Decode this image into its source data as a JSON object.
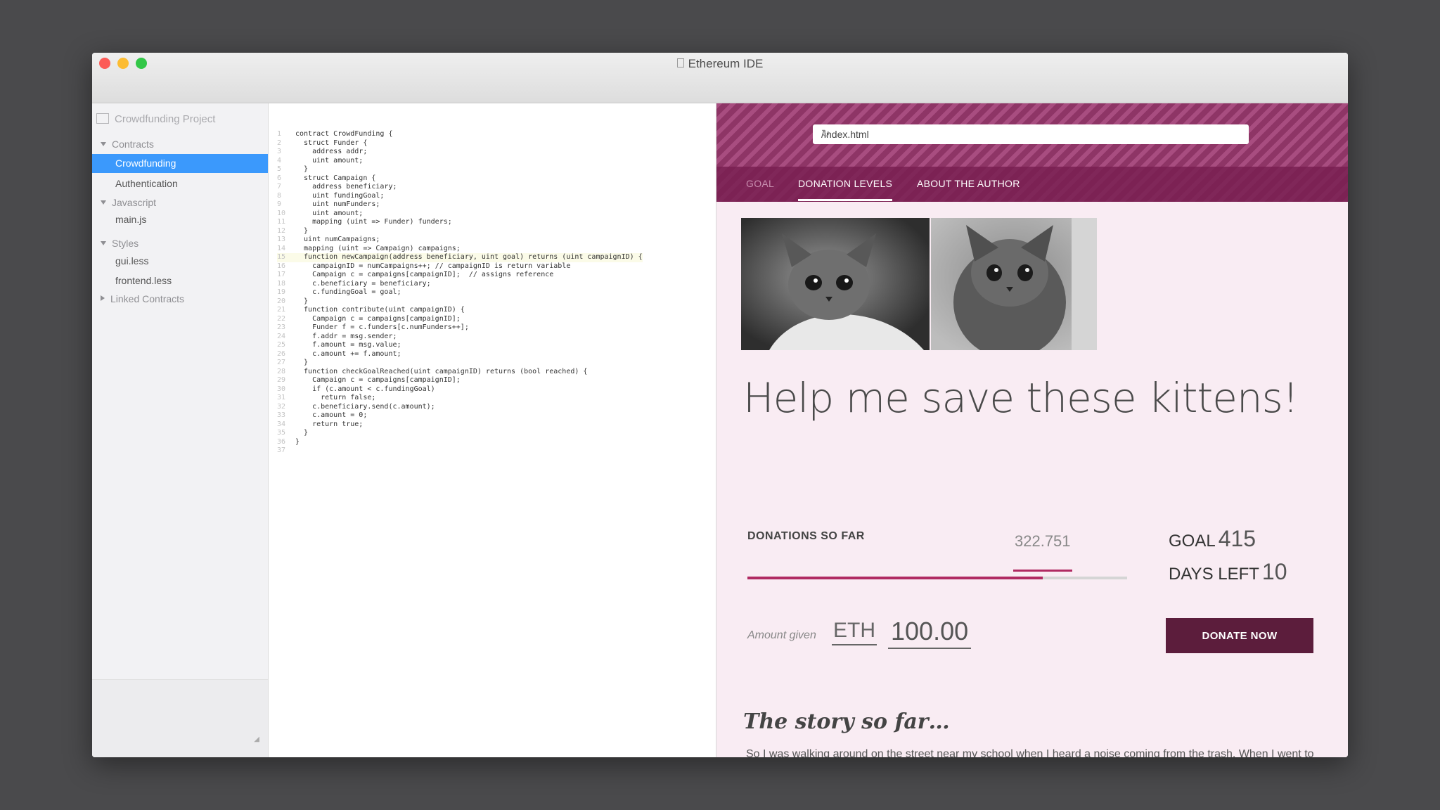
{
  "window": {
    "title": "Ethereum IDE"
  },
  "sidebar": {
    "project": "Crowdfunding Project",
    "groups": [
      {
        "label": "Contracts",
        "items": [
          "Crowdfunding",
          "Authentication"
        ]
      },
      {
        "label": "Javascript",
        "items": [
          "main.js"
        ]
      },
      {
        "label": "Styles",
        "items": [
          "gui.less",
          "frontend.less"
        ]
      },
      {
        "label": "Linked Contracts",
        "items": []
      }
    ]
  },
  "editor": {
    "lines": [
      "contract CrowdFunding {",
      "  struct Funder {",
      "    address addr;",
      "    uint amount;",
      "  }",
      "  struct Campaign {",
      "    address beneficiary;",
      "    uint fundingGoal;",
      "    uint numFunders;",
      "    uint amount;",
      "    mapping (uint => Funder) funders;",
      "  }",
      "  uint numCampaigns;",
      "  mapping (uint => Campaign) campaigns;",
      "  function newCampaign(address beneficiary, uint goal) returns (uint campaignID) {",
      "    campaignID = numCampaigns++; // campaignID is return variable",
      "    Campaign c = campaigns[campaignID];  // assigns reference",
      "    c.beneficiary = beneficiary;",
      "    c.fundingGoal = goal;",
      "  }",
      "  function contribute(uint campaignID) {",
      "    Campaign c = campaigns[campaignID];",
      "    Funder f = c.funders[c.numFunders++];",
      "    f.addr = msg.sender;",
      "    f.amount = msg.value;",
      "    c.amount += f.amount;",
      "  }",
      "  function checkGoalReached(uint campaignID) returns (bool reached) {",
      "    Campaign c = campaigns[campaignID];",
      "    if (c.amount < c.fundingGoal)",
      "      return false;",
      "    c.beneficiary.send(c.amount);",
      "    c.amount = 0;",
      "    return true;",
      "  }",
      "}",
      ""
    ]
  },
  "preview": {
    "url": "/index.html",
    "tabs": [
      "GOAL",
      "DONATION LEVELS",
      "ABOUT THE AUTHOR"
    ],
    "headline": "Help me save these kittens!",
    "donations_label": "DONATIONS SO FAR",
    "donations_value": "322.751",
    "goal_label": "GOAL",
    "goal_value": "415",
    "days_label": "DAYS LEFT",
    "days_value": "10",
    "progress_fraction": 0.7777,
    "amount_label": "Amount given",
    "currency": "ETH",
    "amount_value": "100.00",
    "donate_label": "DONATE NOW",
    "story_title": "The story so far…",
    "story_text": "So I was walking around on the street near my school when I heard a noise coming from the trash. When I went to investigate I found those two, starving kittens! Now I would love to be able to afford keeping them but as a student with no job, the vet bills are accumulating. I need now to spay and neuter them both, and I have to pay six months of kitten food, and a new sofa."
  }
}
